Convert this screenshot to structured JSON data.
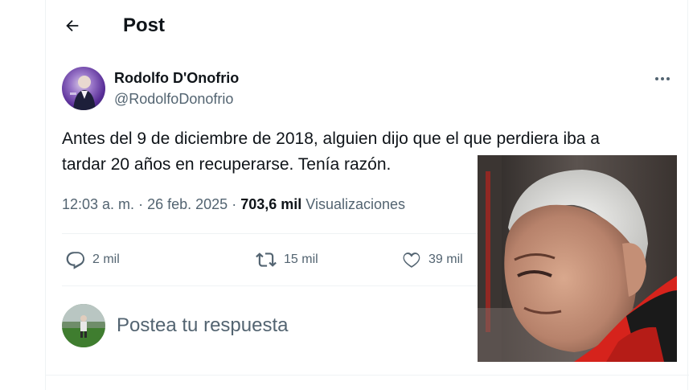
{
  "header": {
    "title": "Post",
    "back_icon": "arrow-left-icon"
  },
  "post": {
    "author": {
      "name": "Rodolfo D'Onofrio",
      "handle": "@RodolfoDonofrio"
    },
    "text_lines": [
      "Antes del 9 de diciembre de 2018, alguien dijo que el que perdiera iba a",
      "tardar 20 años en recuperarse. Tenía razón."
    ],
    "time": "12:03 a. m.",
    "separator": "·",
    "date": "26 feb. 2025",
    "views_count": "703,6 mil",
    "views_label": "Visualizaciones"
  },
  "actions": {
    "replies": {
      "icon": "reply-icon",
      "count": "2 mil"
    },
    "reposts": {
      "icon": "repost-icon",
      "count": "15 mil"
    },
    "likes": {
      "icon": "heart-icon",
      "count": "39 mil"
    }
  },
  "reply_box": {
    "placeholder": "Postea tu respuesta"
  },
  "colors": {
    "text": "#0f1419",
    "secondary": "#536471",
    "border": "#eff3f4",
    "accent_red": "#d6231c"
  }
}
